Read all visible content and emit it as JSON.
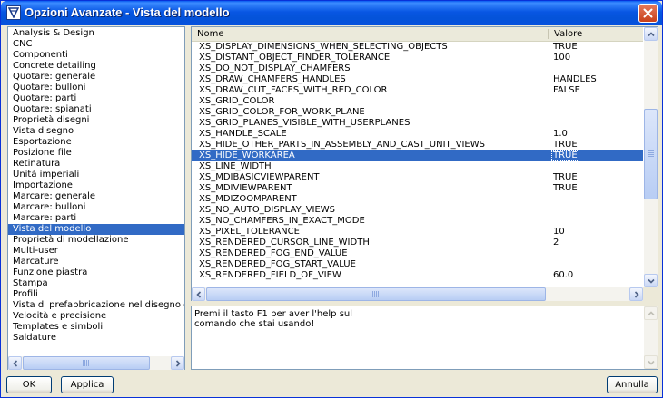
{
  "window": {
    "title": "Opzioni Avanzate - Vista del modello"
  },
  "categories": [
    "Analysis & Design",
    "CNC",
    "Componenti",
    "Concrete detailing",
    "Quotare: generale",
    "Quotare: bulloni",
    "Quotare: parti",
    "Quotare: spianati",
    "Proprietà disegni",
    "Vista disegno",
    "Esportazione",
    "Posizione file",
    "Retinatura",
    "Unità imperiali",
    "Importazione",
    "Marcare: generale",
    "Marcare: bulloni",
    "Marcare: parti",
    "Vista del modello",
    "Proprietà di modellazione",
    "Multi-user",
    "Marcature",
    "Funzione piastra",
    "Stampa",
    "Profili",
    "Vista di prefabbricazione nel disegno di assem",
    "Velocità e precisione",
    "Templates e simboli",
    "Saldature"
  ],
  "selected_category_index": 18,
  "table": {
    "headers": {
      "name": "Nome",
      "value": "Valore"
    },
    "rows": [
      {
        "name": "XS_DISPLAY_DIMENSIONS_WHEN_SELECTING_OBJECTS",
        "value": "TRUE"
      },
      {
        "name": "XS_DISTANT_OBJECT_FINDER_TOLERANCE",
        "value": "100"
      },
      {
        "name": "XS_DO_NOT_DISPLAY_CHAMFERS",
        "value": ""
      },
      {
        "name": "XS_DRAW_CHAMFERS_HANDLES",
        "value": "HANDLES"
      },
      {
        "name": "XS_DRAW_CUT_FACES_WITH_RED_COLOR",
        "value": "FALSE"
      },
      {
        "name": "XS_GRID_COLOR",
        "value": ""
      },
      {
        "name": "XS_GRID_COLOR_FOR_WORK_PLANE",
        "value": ""
      },
      {
        "name": "XS_GRID_PLANES_VISIBLE_WITH_USERPLANES",
        "value": ""
      },
      {
        "name": "XS_HANDLE_SCALE",
        "value": "1.0"
      },
      {
        "name": "XS_HIDE_OTHER_PARTS_IN_ASSEMBLY_AND_CAST_UNIT_VIEWS",
        "value": "TRUE"
      },
      {
        "name": "XS_HIDE_WORKAREA",
        "value": "TRUE"
      },
      {
        "name": "XS_LINE_WIDTH",
        "value": ""
      },
      {
        "name": "XS_MDIBASICVIEWPARENT",
        "value": "TRUE"
      },
      {
        "name": "XS_MDIVIEWPARENT",
        "value": "TRUE"
      },
      {
        "name": "XS_MDIZOOMPARENT",
        "value": ""
      },
      {
        "name": "XS_NO_AUTO_DISPLAY_VIEWS",
        "value": ""
      },
      {
        "name": "XS_NO_CHAMFERS_IN_EXACT_MODE",
        "value": ""
      },
      {
        "name": "XS_PIXEL_TOLERANCE",
        "value": "10"
      },
      {
        "name": "XS_RENDERED_CURSOR_LINE_WIDTH",
        "value": "2"
      },
      {
        "name": "XS_RENDERED_FOG_END_VALUE",
        "value": ""
      },
      {
        "name": "XS_RENDERED_FOG_START_VALUE",
        "value": ""
      },
      {
        "name": "XS_RENDERED_FIELD_OF_VIEW",
        "value": "60.0"
      }
    ],
    "selected_row_index": 10
  },
  "help": {
    "text_line1": "Premi il tasto F1 per aver l'help sul",
    "text_line2": "comando che stai usando!"
  },
  "buttons": {
    "ok": "OK",
    "apply": "Applica",
    "cancel": "Annulla"
  }
}
